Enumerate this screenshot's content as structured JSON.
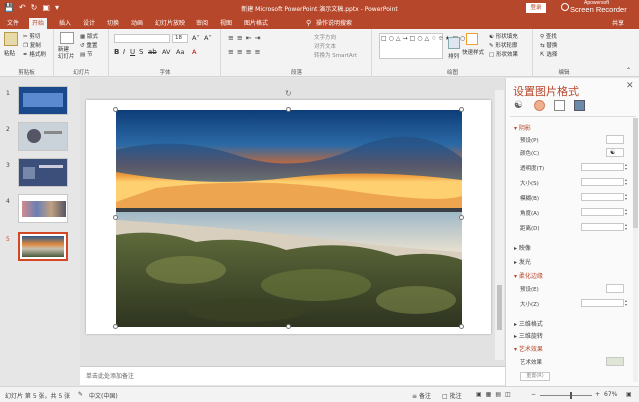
{
  "titlebar": {
    "title": "新建 Microsoft PowerPoint 演示文稿.pptx  -  PowerPoint",
    "login": "登录",
    "watermark_a": "Apowersoft",
    "watermark_b": "Screen Recorder"
  },
  "tabs": [
    {
      "label": "文件",
      "active": false
    },
    {
      "label": "开始",
      "active": true
    },
    {
      "label": "插入",
      "active": false
    },
    {
      "label": "设计",
      "active": false
    },
    {
      "label": "切换",
      "active": false
    },
    {
      "label": "动画",
      "active": false
    },
    {
      "label": "幻灯片放映",
      "active": false
    },
    {
      "label": "审阅",
      "active": false
    },
    {
      "label": "视图",
      "active": false
    },
    {
      "label": "图片格式",
      "active": false
    },
    {
      "label": "操作说明搜索",
      "active": false
    }
  ],
  "share_label": "共享",
  "ribbon": {
    "clipboard": {
      "paste": "粘贴",
      "cut": "剪切",
      "copy": "复制",
      "format_painter": "格式刷",
      "group": "剪贴板"
    },
    "slides": {
      "new_slide": "新建\n幻灯片",
      "layout": "版式",
      "reset": "重置",
      "section": "节",
      "group": "幻灯片"
    },
    "font": {
      "size": "18",
      "group": "字体"
    },
    "paragraph": {
      "text_direction": "文字方向",
      "align_text": "对齐文本",
      "smartart": "转换为 SmartArt",
      "group": "段落"
    },
    "drawing": {
      "arrange": "排列",
      "quick_styles": "快速样式",
      "fill": "形状填充",
      "outline": "形状轮廓",
      "effects": "形状效果",
      "group": "绘图"
    },
    "editing": {
      "find": "查找",
      "replace": "替换",
      "select": "选择",
      "group": "编辑"
    }
  },
  "slides": [
    {
      "num": "1"
    },
    {
      "num": "2"
    },
    {
      "num": "3"
    },
    {
      "num": "4"
    },
    {
      "num": "5"
    }
  ],
  "notes_placeholder": "单击此处添加备注",
  "pane": {
    "title": "设置图片格式",
    "shadow": "阴影",
    "preset": "预设(P)",
    "color": "颜色(C)",
    "transparency": "透明度(T)",
    "size": "大小(S)",
    "blur": "模糊(B)",
    "angle": "角度(A)",
    "distance": "距离(D)",
    "reflection": "映像",
    "glow": "发光",
    "soft_edges": "柔化边缘",
    "se_preset": "预设(E)",
    "se_size": "大小(Z)",
    "three_d_format": "三维格式",
    "three_d_rotation": "三维旋转",
    "artistic": "艺术效果",
    "artistic_effect": "艺术效果",
    "reset": "重置(R)"
  },
  "status": {
    "slide_info": "幻灯片 第 5 张，共 5 张",
    "language": "中文(中国)",
    "notes": "备注",
    "comments": "批注",
    "zoom": "67%"
  },
  "colors": {
    "accent": "#b7472a",
    "selected_thumb": "#d24726"
  }
}
